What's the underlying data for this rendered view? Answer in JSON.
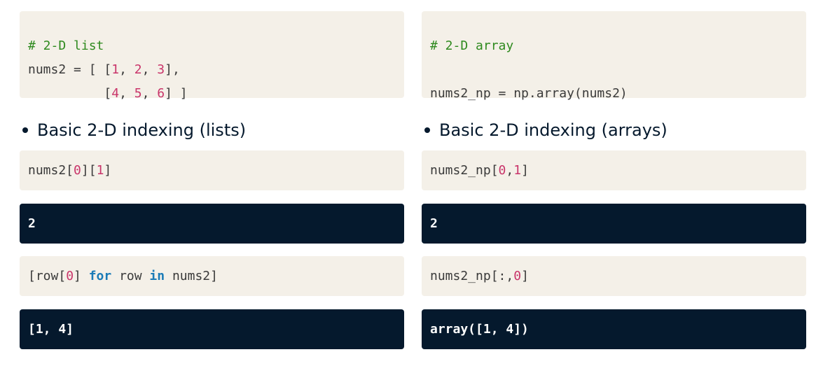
{
  "left": {
    "def_block": {
      "comment": "# 2-D list",
      "line2_text": "nums2 = [ [",
      "row1": [
        "1",
        "2",
        "3"
      ],
      "row2": [
        "4",
        "5",
        "6"
      ]
    },
    "bullet_text": "Basic 2-D indexing (lists)",
    "code1": {
      "prefix": "nums2[",
      "i": "0",
      "mid": "][",
      "j": "1",
      "suffix": "]"
    },
    "output1": "2",
    "code2": {
      "part1": "[row[",
      "idx": "0",
      "part2": "] ",
      "kw_for": "for",
      "part3": " row ",
      "kw_in": "in",
      "part4": " nums2]"
    },
    "output2": "[1, 4]"
  },
  "right": {
    "def_block": {
      "comment": "# 2-D array",
      "assign": "nums2_np = np.array(nums2)"
    },
    "bullet_text": "Basic 2-D indexing (arrays)",
    "code1": {
      "prefix": "nums2_np[",
      "i": "0",
      "sep": ",",
      "j": "1",
      "suffix": "]"
    },
    "output1": "2",
    "code2": {
      "prefix": "nums2_np[:,",
      "idx": "0",
      "suffix": "]"
    },
    "output2": "array([1, 4])"
  },
  "colors": {
    "code_bg": "#f4f0e8",
    "output_bg": "#05192d",
    "comment": "#2f8a1f",
    "number": "#c9356a",
    "keyword": "#1a7bb7"
  }
}
